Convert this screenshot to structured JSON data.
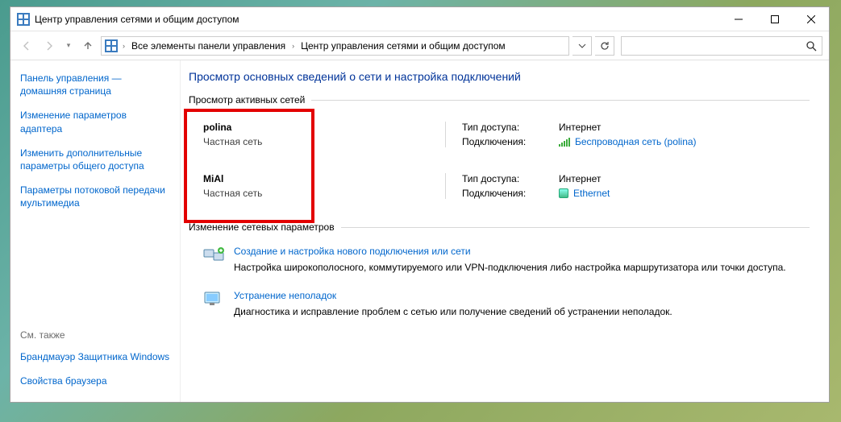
{
  "window": {
    "title": "Центр управления сетями и общим доступом"
  },
  "breadcrumb": {
    "item1": "Все элементы панели управления",
    "item2": "Центр управления сетями и общим доступом"
  },
  "sidebar": {
    "home": "Панель управления — домашняя страница",
    "links": [
      "Изменение параметров адаптера",
      "Изменить дополнительные параметры общего доступа",
      "Параметры потоковой передачи мультимедиа"
    ],
    "seealso_label": "См. также",
    "seealso": [
      "Брандмауэр Защитника Windows",
      "Свойства браузера"
    ]
  },
  "main": {
    "heading": "Просмотр основных сведений о сети и настройка подключений",
    "active_label": "Просмотр активных сетей",
    "networks": [
      {
        "name": "polina",
        "type": "Частная сеть",
        "access_label": "Тип доступа:",
        "access_value": "Интернет",
        "conn_label": "Подключения:",
        "conn_link": "Беспроводная сеть (polina)",
        "icon": "wifi"
      },
      {
        "name": "MiAl",
        "type": "Частная сеть",
        "access_label": "Тип доступа:",
        "access_value": "Интернет",
        "conn_label": "Подключения:",
        "conn_link": "Ethernet",
        "icon": "eth"
      }
    ],
    "change_label": "Изменение сетевых параметров",
    "tasks": [
      {
        "title": "Создание и настройка нового подключения или сети",
        "desc": "Настройка широкополосного, коммутируемого или VPN-подключения либо настройка маршрутизатора или точки доступа."
      },
      {
        "title": "Устранение неполадок",
        "desc": "Диагностика и исправление проблем с сетью или получение сведений об устранении неполадок."
      }
    ]
  }
}
